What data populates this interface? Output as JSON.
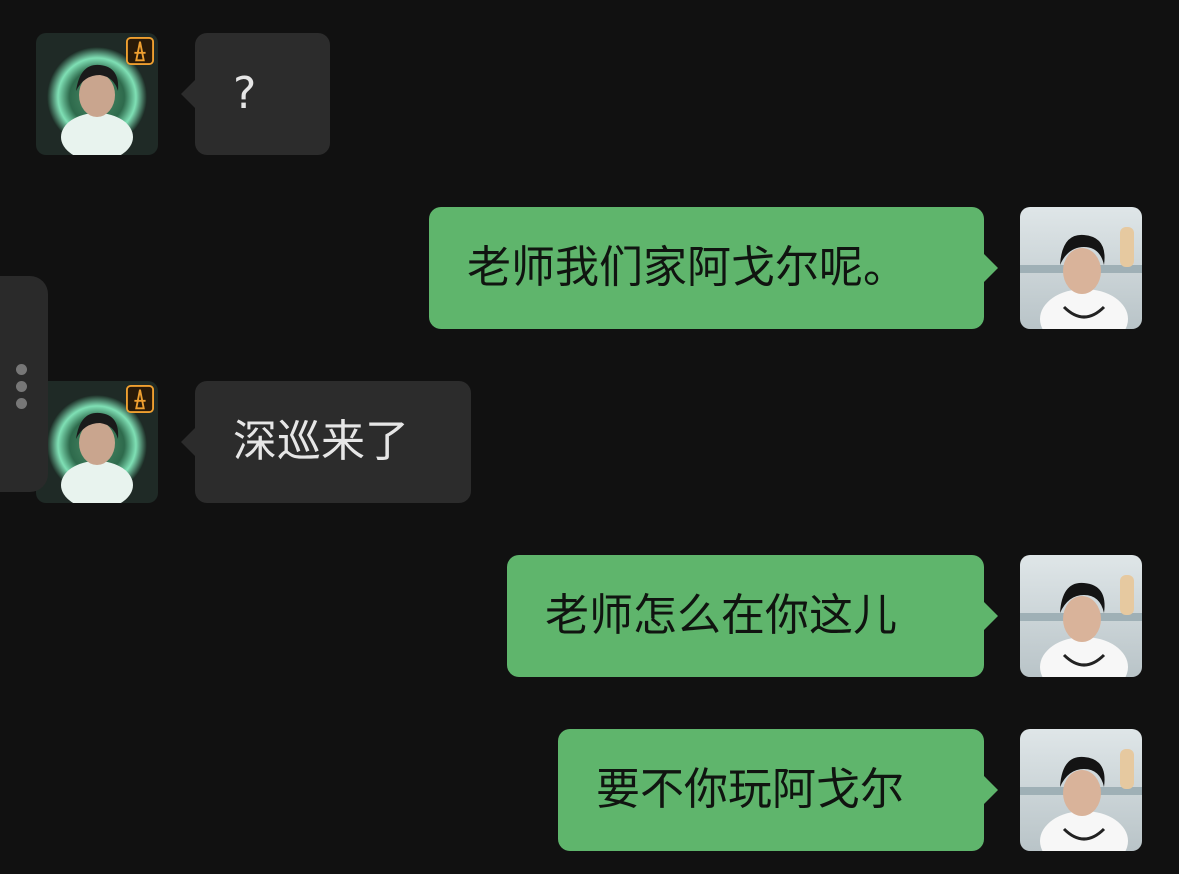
{
  "messages": [
    {
      "side": "incoming",
      "text": "?"
    },
    {
      "side": "outgoing",
      "text": "老师我们家阿戈尔呢。"
    },
    {
      "side": "incoming",
      "text": "深巡来了"
    },
    {
      "side": "outgoing",
      "text": "老师怎么在你这儿"
    },
    {
      "side": "outgoing",
      "text": "要不你玩阿戈尔"
    }
  ],
  "colors": {
    "background": "#111111",
    "incoming_bubble": "#2c2c2c",
    "outgoing_bubble": "#5fb56c",
    "incoming_text": "#e6e6e6",
    "outgoing_text": "#101410"
  },
  "icons": {
    "side_handle": "vertical-dots-icon",
    "contact_badge": "tower-badge-icon"
  }
}
